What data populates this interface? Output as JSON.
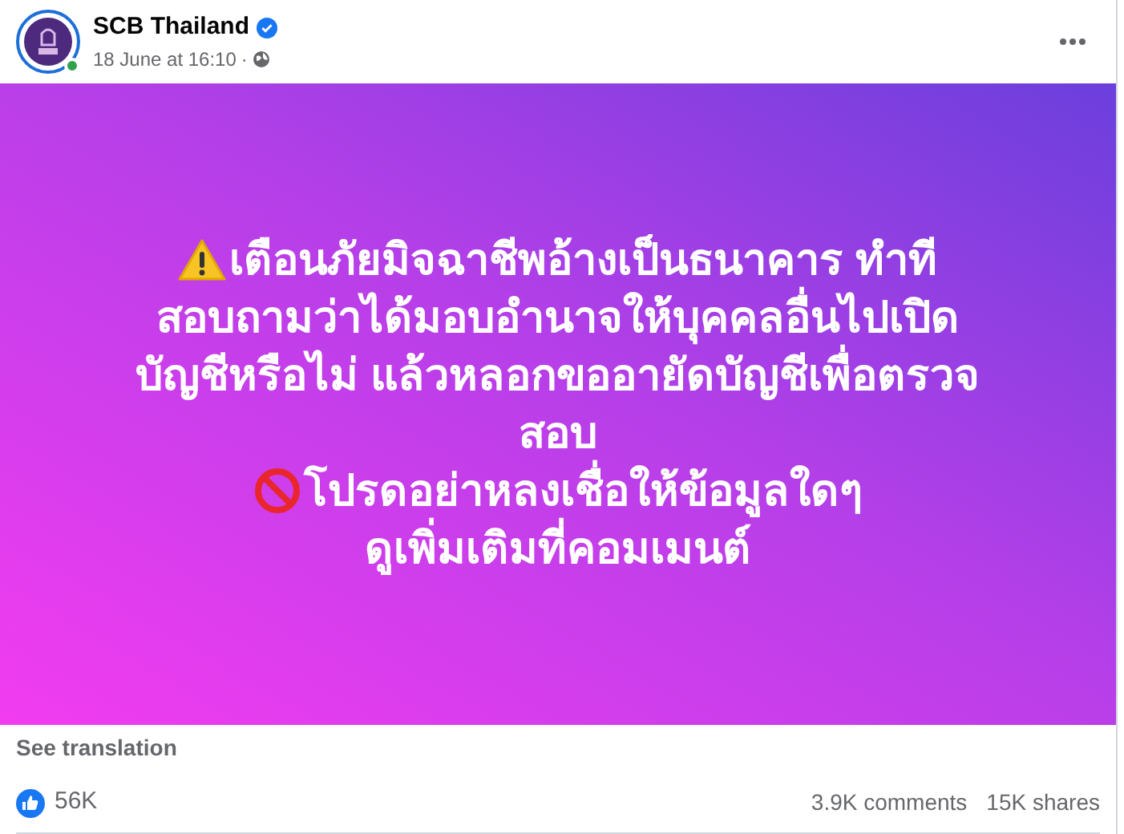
{
  "post": {
    "author": "SCB Thailand",
    "verified": true,
    "online": true,
    "time": "18 June at 16:10",
    "separator": "·"
  },
  "graphic": {
    "lines": [
      {
        "kind": "warning",
        "text": "เตือนภัยมิจฉาชีพอ้างเป็นธนาคาร ทำที"
      },
      {
        "text": "สอบถามว่าได้มอบอำนาจให้บุคคลอื่นไปเปิด"
      },
      {
        "text": "บัญชีหรือไม่ แล้วหลอกขออายัดบัญชีเพื่อตรวจ"
      },
      {
        "text": "สอบ"
      },
      {
        "kind": "prohibited",
        "text": "โปรดอย่าหลงเชื่อให้ข้อมูลใดๆ"
      },
      {
        "text": "ดูเพิ่มเติมที่คอมเมนต์"
      }
    ]
  },
  "see_translation": "See translation",
  "stats": {
    "reactions": "56K",
    "comments": "3.9K comments",
    "shares": "15K shares"
  }
}
